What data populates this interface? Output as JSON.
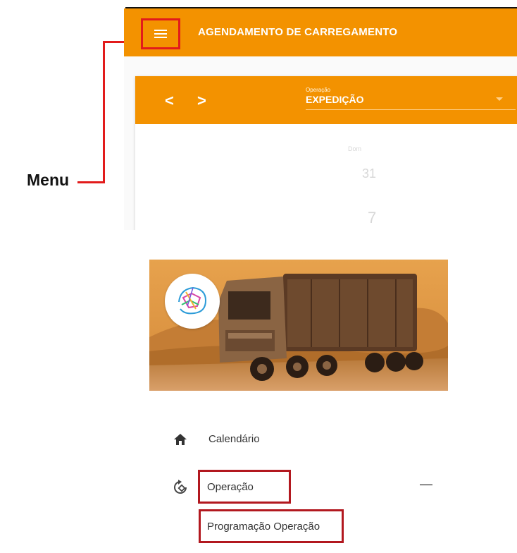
{
  "header": {
    "title": "AGENDAMENTO DE CARREGAMENTO"
  },
  "panel": {
    "prev_label": "<",
    "next_label": ">",
    "operation_label": "Operação",
    "operation_value": "EXPEDIÇÃO",
    "faded_day_label": "Dom",
    "faded_num1": "31",
    "faded_num2": "7"
  },
  "annotation": {
    "menu_label": "Menu"
  },
  "sidebar": {
    "items": [
      {
        "label": "Calendário",
        "icon": "home-icon"
      },
      {
        "label": "Operação",
        "icon": "refresh-icon"
      }
    ],
    "collapse_label": "—",
    "sub_item": "Programação Operação"
  },
  "colors": {
    "accent": "#f39200",
    "highlight": "#e21b1b",
    "highlight_dark": "#b2181f"
  }
}
